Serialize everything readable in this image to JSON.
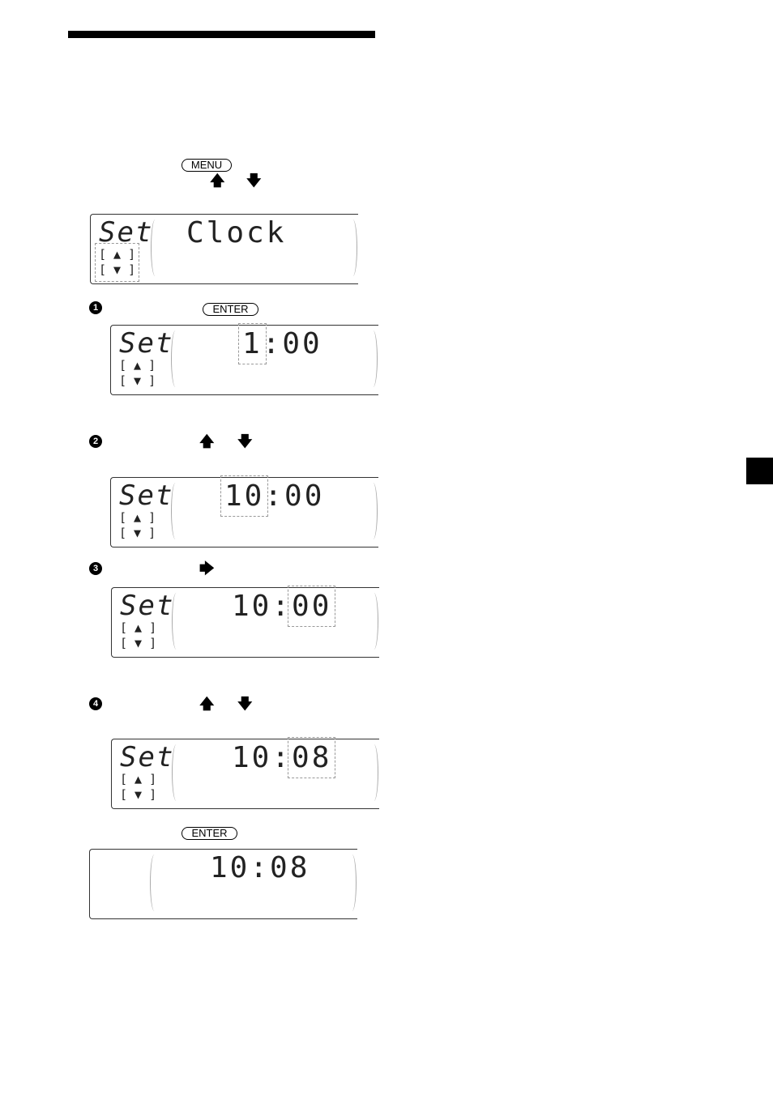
{
  "buttons": {
    "menu": "MENU",
    "enter": "ENTER"
  },
  "steps": [
    "1",
    "2",
    "3",
    "4"
  ],
  "icons": {
    "up": "up-arrow-icon",
    "down": "down-arrow-icon",
    "right": "right-arrow-icon",
    "step": "numbered-circle-icon"
  },
  "displays": [
    {
      "set": "Set",
      "symbols": "[ ▲ ]\n[ ▼ ]",
      "main": "Clock",
      "flash": "Set"
    },
    {
      "set": "Set",
      "symbols": "[ ▲ ]\n[ ▼ ]",
      "main_a": "1",
      "main_b": ":00",
      "flash": "1"
    },
    {
      "set": "Set",
      "symbols": "[ ▲ ]\n[ ▼ ]",
      "main_a": "10",
      "main_b": ":00",
      "flash": "10"
    },
    {
      "set": "Set",
      "symbols": "[ ▲ ]\n[ ▼ ]",
      "main_a": "10:",
      "main_b": "00",
      "flash": "00"
    },
    {
      "set": "Set",
      "symbols": "[ ▲ ]\n[ ▼ ]",
      "main_a": "10:",
      "main_b": "08",
      "flash": "08"
    },
    {
      "main": "10:08"
    }
  ]
}
